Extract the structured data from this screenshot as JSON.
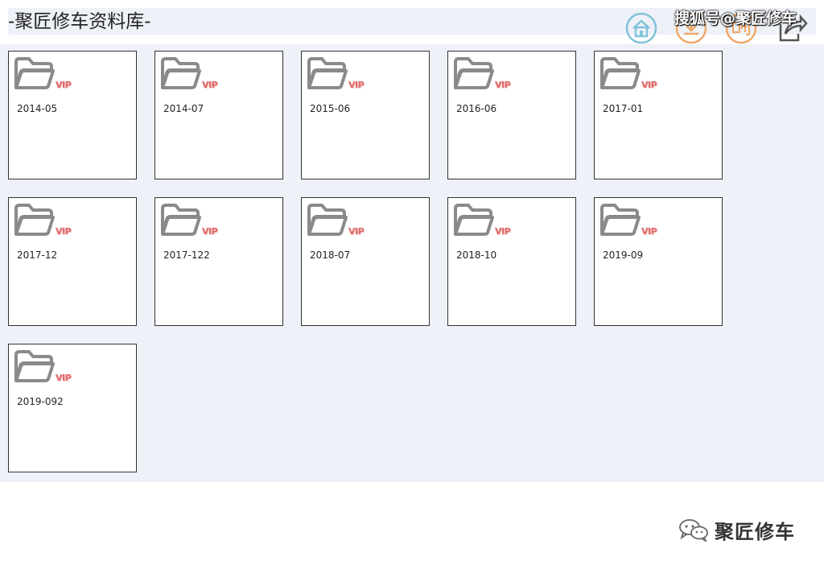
{
  "header": {
    "title": "-聚匠修车资料库-",
    "watermark": "搜狐号@聚匠修车"
  },
  "toolbar": {
    "buttons": [
      {
        "name": "home-icon",
        "color": "#7fc3da"
      },
      {
        "name": "download-icon",
        "color": "#f0a868"
      },
      {
        "name": "buy-icon",
        "color": "#f0a868"
      },
      {
        "name": "share-icon",
        "color": "#555555"
      }
    ]
  },
  "folders": [
    {
      "label": "2014-05",
      "badge": "VIP"
    },
    {
      "label": "2014-07",
      "badge": "VIP"
    },
    {
      "label": "2015-06",
      "badge": "VIP"
    },
    {
      "label": "2016-06",
      "badge": "VIP"
    },
    {
      "label": "2017-01",
      "badge": "VIP"
    },
    {
      "label": "2017-12",
      "badge": "VIP"
    },
    {
      "label": "2017-122",
      "badge": "VIP"
    },
    {
      "label": "2018-07",
      "badge": "VIP"
    },
    {
      "label": "2018-10",
      "badge": "VIP"
    },
    {
      "label": "2019-09",
      "badge": "VIP"
    },
    {
      "label": "2019-092",
      "badge": "VIP"
    }
  ],
  "footer": {
    "brand": "聚匠修车",
    "icon": "wechat-icon"
  },
  "colors": {
    "background": "#eef1f7",
    "folder_icon": "#8a8a8a",
    "vip": "#e06a6a"
  }
}
